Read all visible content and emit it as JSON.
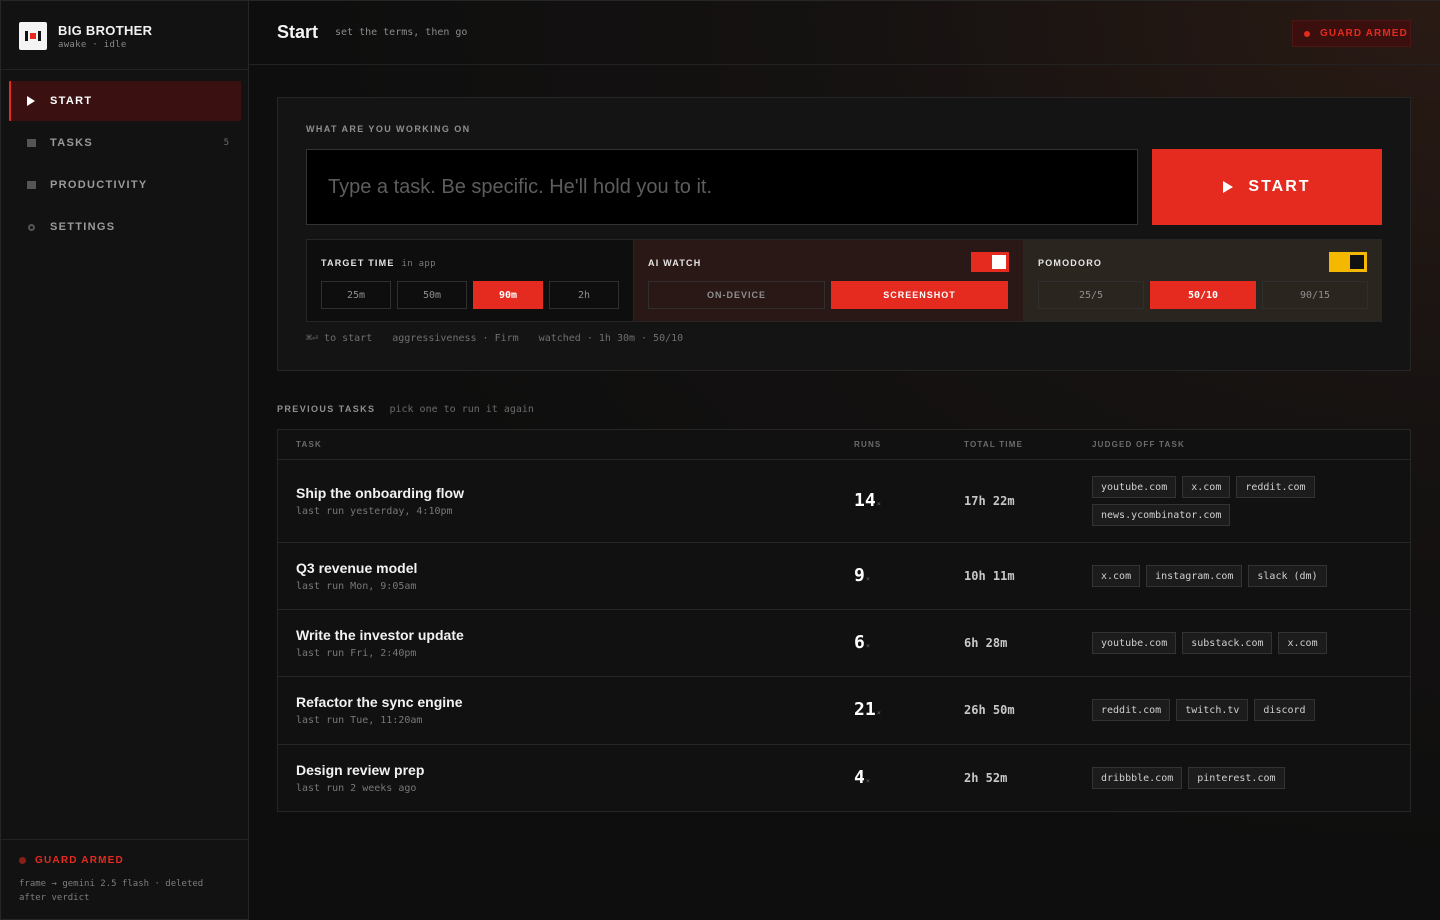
{
  "app": {
    "name": "BIG BROTHER",
    "status": "awake · idle"
  },
  "nav": [
    {
      "label": "START",
      "count": ""
    },
    {
      "label": "TASKS",
      "count": "5"
    },
    {
      "label": "PRODUCTIVITY",
      "count": ""
    },
    {
      "label": "SETTINGS",
      "count": ""
    }
  ],
  "sidebar_footer": {
    "guard": "GUARD ARMED",
    "note": "frame → gemini 2.5 flash · deleted after verdict"
  },
  "header": {
    "title": "Start",
    "subtitle": "set the terms, then go",
    "guard_badge": "GUARD ARMED"
  },
  "composer": {
    "label": "WHAT ARE YOU WORKING ON",
    "placeholder": "Type a task. Be specific. He'll hold you to it.",
    "start_label": "START"
  },
  "target_time": {
    "title": "TARGET TIME",
    "sub": "in app",
    "options": [
      "25m",
      "50m",
      "90m",
      "2h"
    ],
    "selected": "90m"
  },
  "ai_watch": {
    "title": "AI WATCH",
    "enabled": true,
    "options": [
      "ON-DEVICE",
      "SCREENSHOT"
    ],
    "selected": "SCREENSHOT"
  },
  "pomodoro": {
    "title": "POMODORO",
    "enabled": true,
    "options": [
      "25/5",
      "50/10",
      "90/15"
    ],
    "selected": "50/10"
  },
  "hints": [
    "⌘⏎ to start",
    "aggressiveness · Firm",
    "watched · 1h 30m · 50/10"
  ],
  "previous": {
    "title": "PREVIOUS TASKS",
    "subtitle": "pick one to run it again",
    "columns": [
      "TASK",
      "RUNS",
      "TOTAL TIME",
      "JUDGED OFF TASK"
    ],
    "rows": [
      {
        "name": "Ship the onboarding flow",
        "last": "last run yesterday, 4:10pm",
        "runs": "14",
        "total": "17h 22m",
        "tags": [
          "youtube.com",
          "x.com",
          "reddit.com",
          "news.ycombinator.com"
        ]
      },
      {
        "name": "Q3 revenue model",
        "last": "last run Mon, 9:05am",
        "runs": "9",
        "total": "10h 11m",
        "tags": [
          "x.com",
          "instagram.com",
          "slack (dm)"
        ]
      },
      {
        "name": "Write the investor update",
        "last": "last run Fri, 2:40pm",
        "runs": "6",
        "total": "6h 28m",
        "tags": [
          "youtube.com",
          "substack.com",
          "x.com"
        ]
      },
      {
        "name": "Refactor the sync engine",
        "last": "last run Tue, 11:20am",
        "runs": "21",
        "total": "26h 50m",
        "tags": [
          "reddit.com",
          "twitch.tv",
          "discord"
        ]
      },
      {
        "name": "Design review prep",
        "last": "last run 2 weeks ago",
        "runs": "4",
        "total": "2h 52m",
        "tags": [
          "dribbble.com",
          "pinterest.com"
        ]
      }
    ],
    "runs_suffix": "×"
  },
  "colors": {
    "accent": "#e52b20",
    "pomodoro_toggle": "#f5b800",
    "bg": "#0d0d0d"
  },
  "icons": {
    "start": "play-icon",
    "tasks": "square-icon",
    "productivity": "square-icon",
    "settings": "gear-icon"
  }
}
